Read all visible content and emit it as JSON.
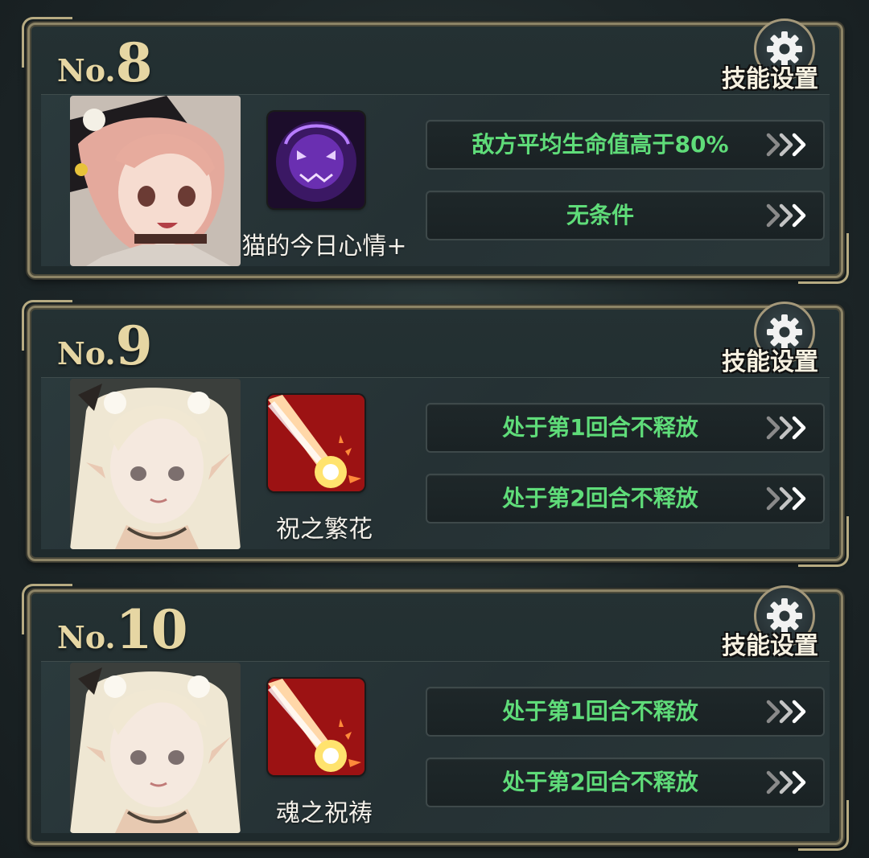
{
  "settings_label": "技能设置",
  "colors": {
    "condition_text": "#5fdc79",
    "rank_text": "#e6d6a3",
    "frame_gold": "#8d8466"
  },
  "cards": [
    {
      "rank_prefix": "No.",
      "rank_number": "8",
      "skill_name": "猫的今日心情+",
      "skill_icon": "purple-cat-spirit-icon",
      "portrait": "pink-hair-witch-portrait",
      "conditions": [
        "敌方平均生命值高于80%",
        "无条件"
      ]
    },
    {
      "rank_prefix": "No.",
      "rank_number": "9",
      "skill_name": "祝之繁花",
      "skill_icon": "red-light-beam-icon",
      "portrait": "blonde-elf-portrait",
      "conditions": [
        "处于第1回合不释放",
        "处于第2回合不释放"
      ]
    },
    {
      "rank_prefix": "No.",
      "rank_number": "10",
      "skill_name": "魂之祝祷",
      "skill_icon": "red-light-beam-icon",
      "portrait": "blonde-elf-portrait",
      "conditions": [
        "处于第1回合不释放",
        "处于第2回合不释放"
      ]
    }
  ]
}
